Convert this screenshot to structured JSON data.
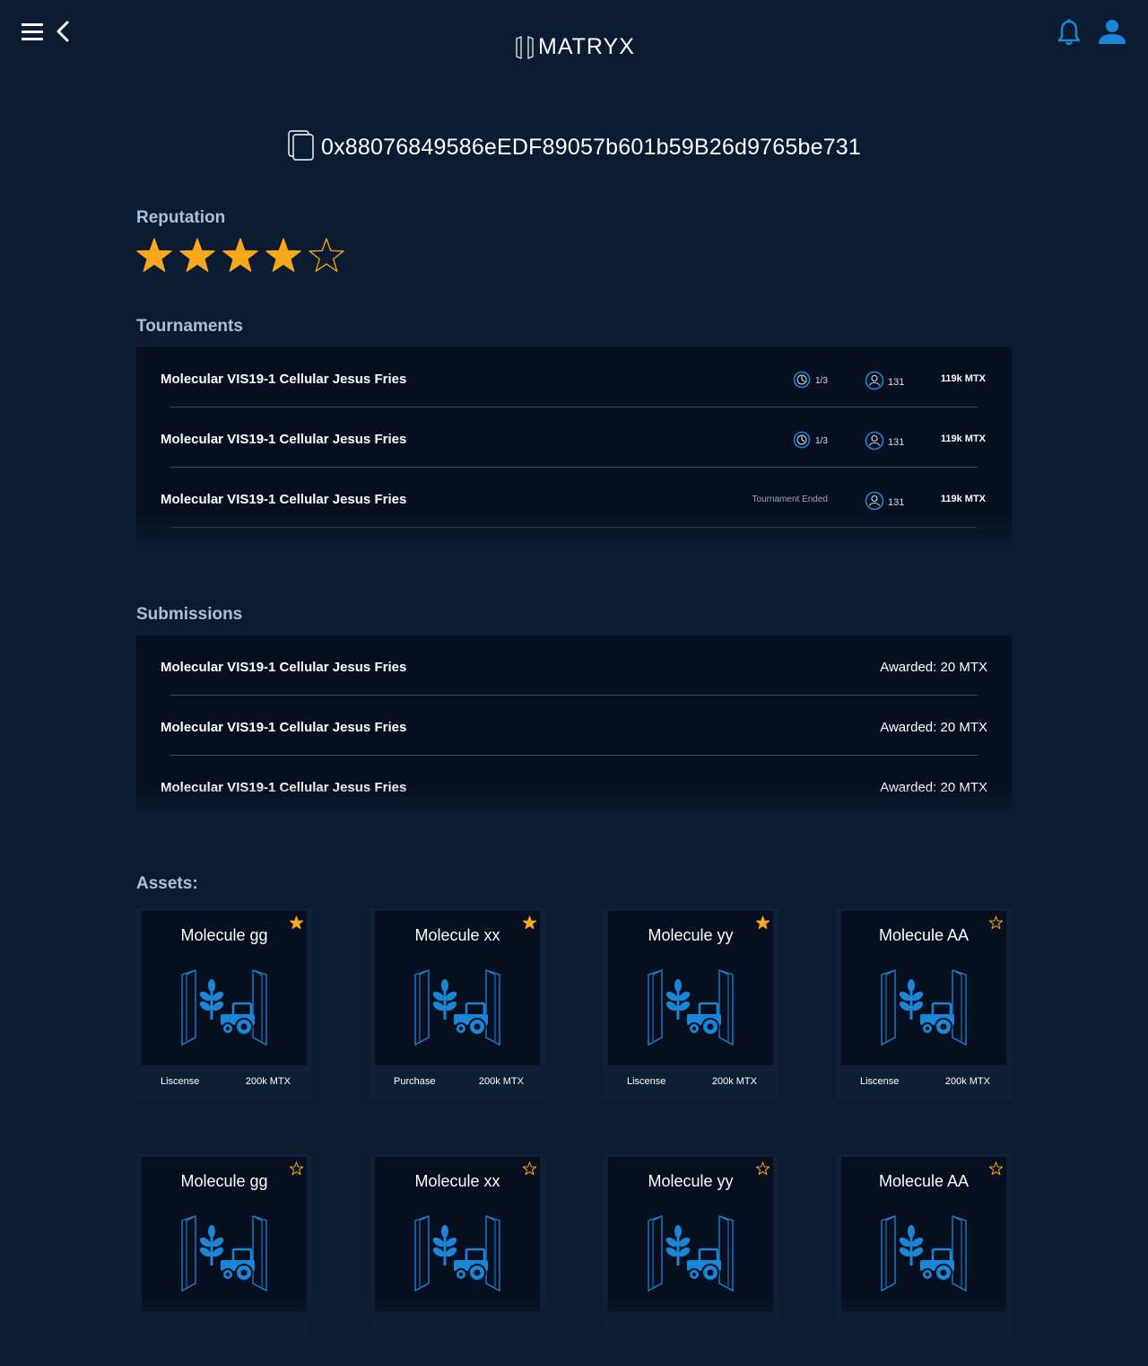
{
  "header": {
    "logo_text": "MATRYX",
    "icons": [
      "menu-icon",
      "back-icon",
      "bell-icon",
      "user-icon"
    ]
  },
  "profile": {
    "address": "0x88076849586eEDF89057b601b59B26d9765be731",
    "reputation_label": "Reputation",
    "reputation_rating": 4,
    "reputation_max": 5
  },
  "tournaments": {
    "title": "Tournaments",
    "rows": [
      {
        "title": "Molecular VIS19-1 Cellular Jesus Fries",
        "status": "1/3",
        "participants": "131",
        "bounty": "119k MTX"
      },
      {
        "title": "Molecular VIS19-1 Cellular Jesus Fries",
        "status": "1/3",
        "participants": "131",
        "bounty": "119k MTX"
      },
      {
        "title": "Molecular VIS19-1 Cellular Jesus Fries",
        "status": "Tournament Ended",
        "participants": "131",
        "bounty": "119k MTX"
      }
    ]
  },
  "submissions": {
    "title": "Submissions",
    "rows": [
      {
        "title": "Molecular VIS19-1 Cellular Jesus Fries",
        "reward": "Awarded: 20 MTX"
      },
      {
        "title": "Molecular VIS19-1 Cellular Jesus Fries",
        "reward": "Awarded: 20 MTX"
      },
      {
        "title": "Molecular VIS19-1 Cellular Jesus Fries",
        "reward": "Awarded: 20 MTX"
      }
    ]
  },
  "assets": {
    "title": "Assets:",
    "items": [
      {
        "name": "Molecule gg",
        "starred": true,
        "action": "Liscense",
        "price": "200k MTX"
      },
      {
        "name": "Molecule xx",
        "starred": true,
        "action": "Purchase",
        "price": "200k MTX"
      },
      {
        "name": "Molecule yy",
        "starred": true,
        "action": "Liscense",
        "price": "200k MTX"
      },
      {
        "name": "Molecule AA",
        "starred": false,
        "action": "Liscense",
        "price": "200k MTX"
      },
      {
        "name": "Molecule gg",
        "starred": false
      },
      {
        "name": "Molecule xx",
        "starred": false
      },
      {
        "name": "Molecule yy",
        "starred": false
      },
      {
        "name": "Molecule AA",
        "starred": false
      }
    ]
  },
  "colors": {
    "background": "#0b1b31",
    "panel": "#050f1f",
    "accent_blue": "#1a87d6",
    "star_gold": "#f7a81b",
    "section_title": "#a9c0d8"
  }
}
